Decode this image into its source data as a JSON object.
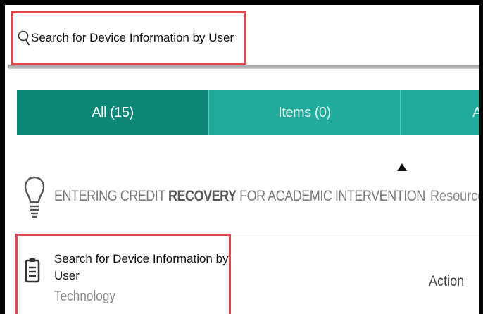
{
  "search": {
    "text": "Search for Device Information by User",
    "icon": "search-icon"
  },
  "tabs": [
    {
      "label": "All (15)",
      "active": true
    },
    {
      "label": "Items (0)",
      "active": false
    },
    {
      "label": "A",
      "active": false
    }
  ],
  "sort_indicator": "sort-up-arrow-icon",
  "results": [
    {
      "icon": "lightbulb-icon",
      "title_pre": "ENTERING CREDIT ",
      "title_bold": "RECOVERY",
      "title_post": " FOR ACADEMIC INTERVENTION",
      "type": "Resource"
    },
    {
      "icon": "clipboard-icon",
      "title": "Search for Device Information by User",
      "category": "Technology",
      "type": "Action"
    }
  ],
  "colors": {
    "tab_active": "#0d8778",
    "tab_inactive": "#20ab9a",
    "highlight_border": "#e0474c"
  }
}
